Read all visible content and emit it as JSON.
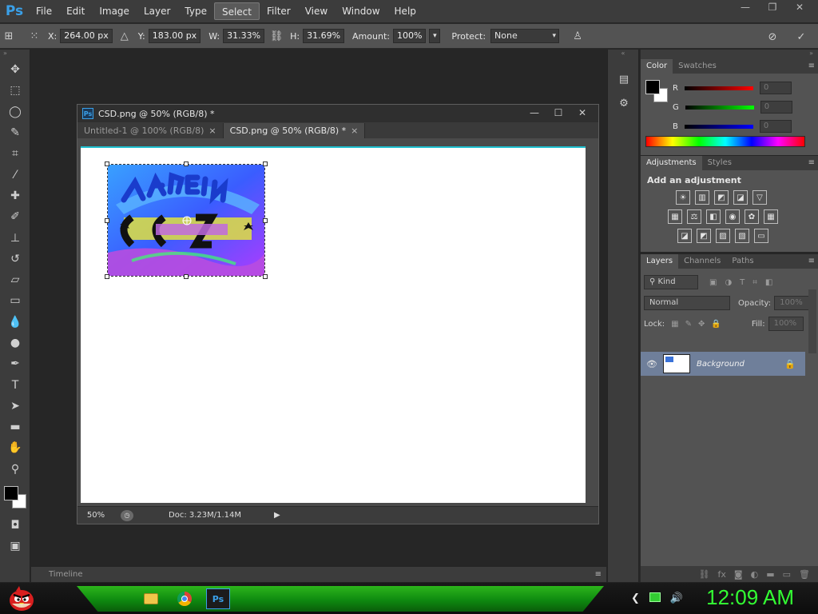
{
  "app": {
    "logo": "Ps",
    "menu": [
      "File",
      "Edit",
      "Image",
      "Layer",
      "Type",
      "Select",
      "Filter",
      "View",
      "Window",
      "Help"
    ],
    "active_menu_index": 5,
    "window_controls": [
      "minimize-icon",
      "restore-icon",
      "close-icon"
    ]
  },
  "options_bar": {
    "x_label": "X:",
    "x_value": "264.00 px",
    "y_label": "Y:",
    "y_value": "183.00 px",
    "w_label": "W:",
    "w_value": "31.33%",
    "h_label": "H:",
    "h_value": "31.69%",
    "amount_label": "Amount:",
    "amount_value": "100%",
    "protect_label": "Protect:",
    "protect_value": "None"
  },
  "document": {
    "title": "CSD.png @ 50% (RGB/8) *",
    "tabs": [
      {
        "label": "Untitled-1 @ 100% (RGB/8)",
        "close": "×",
        "active": false
      },
      {
        "label": "CSD.png @ 50% (RGB/8) *",
        "close": "×",
        "active": true
      }
    ],
    "zoom": "50%",
    "doc_size": "Doc: 3.23M/1.14M"
  },
  "timeline": {
    "label": "Timeline"
  },
  "color_panel": {
    "tabs": [
      "Color",
      "Swatches"
    ],
    "channels": [
      {
        "label": "R",
        "value": "0",
        "gradient": "linear-gradient(90deg,#000,#ff0000)"
      },
      {
        "label": "G",
        "value": "0",
        "gradient": "linear-gradient(90deg,#000,#00ff00)"
      },
      {
        "label": "B",
        "value": "0",
        "gradient": "linear-gradient(90deg,#000,#0000ff)"
      }
    ]
  },
  "adjustments_panel": {
    "tabs": [
      "Adjustments",
      "Styles"
    ],
    "title": "Add an adjustment",
    "rows": [
      [
        "☀",
        "▥",
        "◩",
        "◪",
        "▽"
      ],
      [
        "▦",
        "⚖",
        "◧",
        "◉",
        "✿",
        "▦"
      ],
      [
        "◪",
        "◩",
        "▨",
        "▧",
        "▭"
      ]
    ]
  },
  "layers_panel": {
    "tabs": [
      "Layers",
      "Channels",
      "Paths"
    ],
    "kind_label": "Kind",
    "blend_mode": "Normal",
    "opacity_label": "Opacity:",
    "opacity_value": "100%",
    "lock_label": "Lock:",
    "fill_label": "Fill:",
    "fill_value": "100%",
    "layers": [
      {
        "name": "Background",
        "visible": true,
        "locked": true
      }
    ],
    "footer_icons": [
      "link-icon",
      "fx-icon",
      "mask-icon",
      "adjustment-icon",
      "folder-icon",
      "new-layer-icon",
      "trash-icon"
    ]
  },
  "taskbar": {
    "clock": "12:09 AM",
    "clock_color": "#33ff33",
    "apps": [
      "folder-icon",
      "chrome-icon",
      "photoshop-icon"
    ]
  },
  "colors": {
    "accent_blue": "#3aa0e8",
    "canvas_border": "#1fbfcf",
    "layer_selected": "#6f7f9a"
  }
}
